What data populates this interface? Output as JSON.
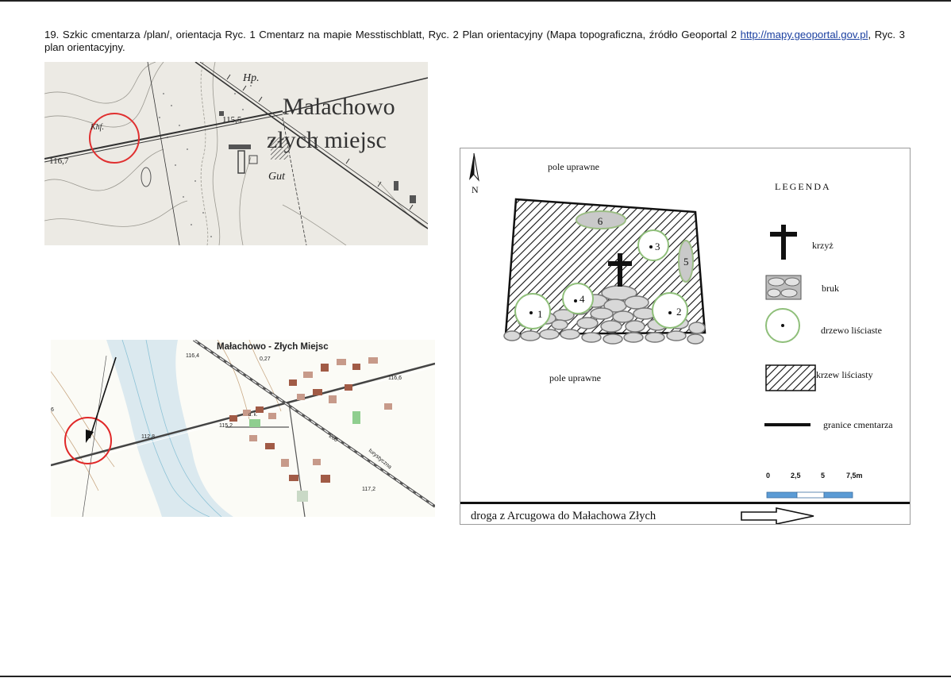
{
  "caption": {
    "part1": "19. Szkic cmentarza /plan/, orientacja Ryc. 1 Cmentarz na mapie Messtischblatt, Ryc. 2 Plan orientacyjny (Mapa topograficzna, źródło Geoportal 2",
    "link": "http://mapy.geoportal.gov.pl",
    "part2": ", Ryc. 3 plan orientacyjny."
  },
  "map1": {
    "place_name_1": "Malachowo",
    "place_name_2": "złych miejsc",
    "label_hp": "Hp.",
    "label_khf": "Khf.",
    "label_gut": "Gut",
    "height_1": "116,7",
    "height_2": "115,5"
  },
  "map2": {
    "title": "Małachowo - Złych Miejsc",
    "sub_value": "0,27",
    "height_1": "116,4",
    "height_2": "116,6",
    "height_3": "115,2",
    "height_4": "112,8",
    "height_5": "117,2",
    "label_6": "6",
    "label_dk": "d. k.",
    "road_number": "260",
    "trail_label": "turystyczna"
  },
  "plan": {
    "north_label": "N",
    "field_top": "pole uprawne",
    "field_bottom": "pole uprawne",
    "trees": [
      "1",
      "2",
      "3",
      "4"
    ],
    "shrubs": [
      "5",
      "6"
    ],
    "legend_title": "LEGENDA",
    "legend": {
      "cross": "krzyż",
      "cobble": "bruk",
      "tree": "drzewo liściaste",
      "shrub": "krzew liściasty",
      "border": "granice cmentarza"
    },
    "scale_labels": [
      "0",
      "2,5",
      "5",
      "7,5m"
    ],
    "road_label": "droga z Arcugowa do Małachowa Złych"
  }
}
